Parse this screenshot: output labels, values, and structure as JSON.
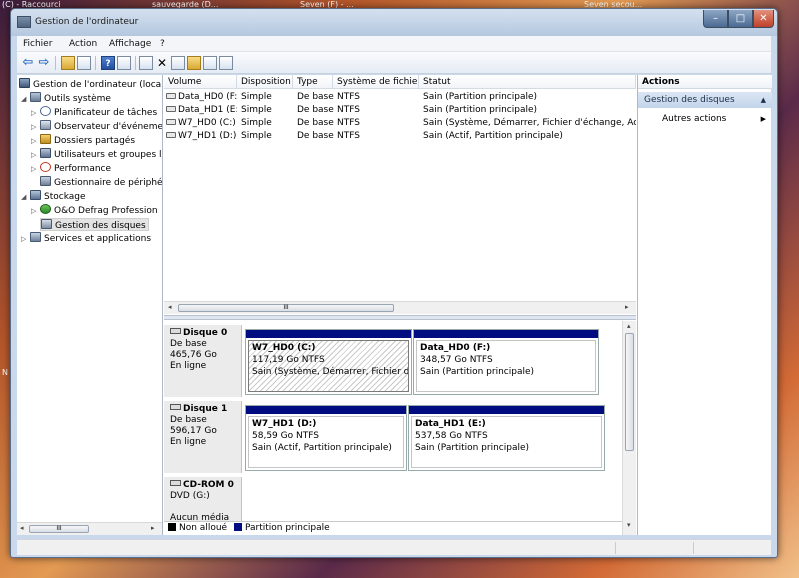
{
  "desktop": {
    "taskbar_items": [
      "(C) - Raccourci",
      "sauvegarde (D...",
      "Seven (F) - ...",
      "Seven secou..."
    ],
    "side_letter": "N"
  },
  "window": {
    "title": "Gestion de l'ordinateur",
    "controls": {
      "minimize": "–",
      "maximize": "□",
      "close": "✕"
    }
  },
  "menu": [
    "Fichier",
    "Action",
    "Affichage",
    "?"
  ],
  "toolbar": {
    "icons": [
      "back-arrow-icon",
      "forward-arrow-icon",
      "up-folder-icon",
      "show-hide-tree-icon",
      "help-icon",
      "properties-icon",
      "refresh-icon",
      "delete-icon",
      "edit-icon",
      "open-folder-icon",
      "search-icon",
      "disk-properties-icon"
    ],
    "back": "⇦",
    "forward": "⇨",
    "delete": "✕"
  },
  "tree": {
    "items": [
      {
        "label": "Gestion de l'ordinateur (local)",
        "level": 0,
        "expander": "",
        "icon": "computer-icon"
      },
      {
        "label": "Outils système",
        "level": 1,
        "expander": "◢",
        "icon": "tools-icon"
      },
      {
        "label": "Planificateur de tâches",
        "level": 2,
        "expander": "▷",
        "icon": "clock-icon"
      },
      {
        "label": "Observateur d'événeme",
        "level": 2,
        "expander": "▷",
        "icon": "event-log-icon"
      },
      {
        "label": "Dossiers partagés",
        "level": 2,
        "expander": "▷",
        "icon": "shared-folder-icon"
      },
      {
        "label": "Utilisateurs et groupes l",
        "level": 2,
        "expander": "▷",
        "icon": "users-icon"
      },
      {
        "label": "Performance",
        "level": 2,
        "expander": "▷",
        "icon": "performance-icon"
      },
      {
        "label": "Gestionnaire de périphé",
        "level": 2,
        "expander": "",
        "icon": "device-manager-icon"
      },
      {
        "label": "Stockage",
        "level": 1,
        "expander": "◢",
        "icon": "storage-icon"
      },
      {
        "label": "O&O Defrag Profession",
        "level": 2,
        "expander": "▷",
        "icon": "defrag-icon"
      },
      {
        "label": "Gestion des disques",
        "level": 2,
        "expander": "",
        "icon": "disk-management-icon",
        "selected": true
      },
      {
        "label": "Services et applications",
        "level": 1,
        "expander": "▷",
        "icon": "services-icon"
      }
    ],
    "scroll_mark": "III"
  },
  "volumes": {
    "headers": [
      "Volume",
      "Disposition",
      "Type",
      "Système de fichiers",
      "Statut"
    ],
    "rows": [
      [
        "Data_HD0 (F:)",
        "Simple",
        "De base",
        "NTFS",
        "Sain (Partition principale)"
      ],
      [
        "Data_HD1 (E:)",
        "Simple",
        "De base",
        "NTFS",
        "Sain (Partition principale)"
      ],
      [
        "W7_HD0 (C:)",
        "Simple",
        "De base",
        "NTFS",
        "Sain (Système, Démarrer, Fichier d'échange, Acti"
      ],
      [
        "W7_HD1 (D:)",
        "Simple",
        "De base",
        "NTFS",
        "Sain (Actif, Partition principale)"
      ]
    ],
    "scroll_mark": "III"
  },
  "disks": [
    {
      "name": "Disque 0",
      "type": "De base",
      "size": "465,76 Go",
      "state": "En ligne",
      "partitions": [
        {
          "name": "W7_HD0  (C:)",
          "size": "117,19 Go NTFS",
          "status": "Sain (Système, Démarrer, Fichier d'écha",
          "hatched": true
        },
        {
          "name": "Data_HD0  (F:)",
          "size": "348,57 Go NTFS",
          "status": "Sain (Partition principale)"
        }
      ]
    },
    {
      "name": "Disque 1",
      "type": "De base",
      "size": "596,17 Go",
      "state": "En ligne",
      "partitions": [
        {
          "name": "W7_HD1  (D:)",
          "size": "58,59 Go NTFS",
          "status": "Sain (Actif, Partition principale)"
        },
        {
          "name": "Data_HD1  (E:)",
          "size": "537,58 Go NTFS",
          "status": "Sain (Partition principale)"
        }
      ]
    },
    {
      "name": "CD-ROM 0",
      "type": "DVD (G:)",
      "state": "Aucun média"
    }
  ],
  "legend": {
    "unallocated": "Non alloué",
    "primary": "Partition principale",
    "colors": {
      "unallocated": "#000000",
      "primary": "#000c80"
    }
  },
  "actions": {
    "header": "Actions",
    "section": "Gestion des disques",
    "section_caret": "▲",
    "items": [
      {
        "label": "Autres actions",
        "caret": "▶"
      }
    ]
  }
}
